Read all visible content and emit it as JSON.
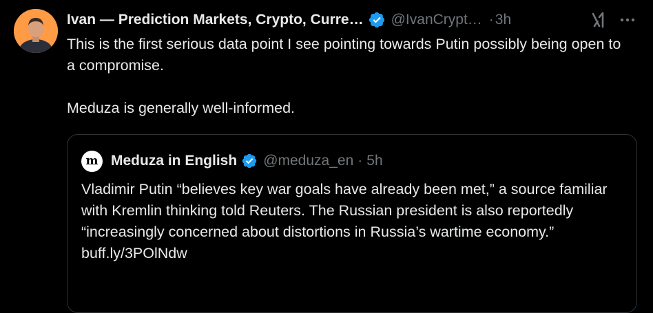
{
  "tweet": {
    "author": {
      "display_name": "Ivan — Prediction Markets, Crypto, Curre…",
      "handle": "@IvanCrypt…",
      "verified": true,
      "avatar_icon": "profile-photo"
    },
    "separator": "·",
    "time": "3h",
    "actions": {
      "grok_icon": "grok-icon",
      "more_icon": "more-horizontal-icon"
    },
    "text_paragraphs": [
      "This is the first serious data point I see pointing towards Putin possibly being open to a compromise.",
      "Meduza is generally well-informed."
    ],
    "quote": {
      "avatar_letter": "m",
      "display_name": "Meduza in English",
      "handle": "@meduza_en",
      "separator": "·",
      "time": "5h",
      "verified": true,
      "text": "Vladimir Putin “believes key war goals have already been met,” a source familiar with Kremlin thinking told Reuters. The Russian president is also reportedly “increasingly concerned about distortions in Russia’s wartime economy.”",
      "link": "buff.ly/3POlNdw"
    }
  },
  "colors": {
    "background": "#000000",
    "text_primary": "#e7e9ea",
    "text_secondary": "#71767b",
    "border": "#2f3336",
    "verified_blue": "#1d9bf0"
  }
}
